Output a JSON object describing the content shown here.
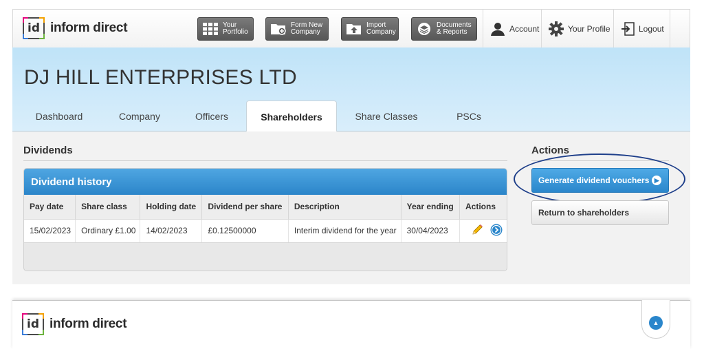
{
  "brand": {
    "text": "inform direct",
    "mark": "id"
  },
  "topnav": {
    "buttons": [
      {
        "label": "Your\nPortfolio",
        "icon": "grid-icon"
      },
      {
        "label": "Form New\nCompany",
        "icon": "folder-add-icon"
      },
      {
        "label": "Import\nCompany",
        "icon": "upload-folder-icon"
      },
      {
        "label": "Documents\n& Reports",
        "icon": "documents-icon"
      }
    ],
    "account": "Account",
    "profile": "Your Profile",
    "logout": "Logout"
  },
  "company": {
    "name": "DJ HILL ENTERPRISES LTD"
  },
  "tabs": [
    "Dashboard",
    "Company",
    "Officers",
    "Shareholders",
    "Share Classes",
    "PSCs"
  ],
  "active_tab": "Shareholders",
  "dividends": {
    "section_title": "Dividends",
    "panel_title": "Dividend history",
    "columns": [
      "Pay date",
      "Share class",
      "Holding date",
      "Dividend per share",
      "Description",
      "Year ending",
      "Actions"
    ],
    "rows": [
      {
        "pay_date": "15/02/2023",
        "share_class": "Ordinary £1.00",
        "holding_date": "14/02/2023",
        "dividend_per_share": "£0.12500000",
        "description": "Interim dividend for the year",
        "year_ending": "30/04/2023"
      }
    ]
  },
  "actions": {
    "title": "Actions",
    "generate_label": "Generate dividend vouchers",
    "return_label": "Return to shareholders"
  },
  "colors": {
    "accent": "#2a86cb",
    "header_band": "#cde9f9",
    "highlight_ellipse": "#1e3f8a"
  }
}
